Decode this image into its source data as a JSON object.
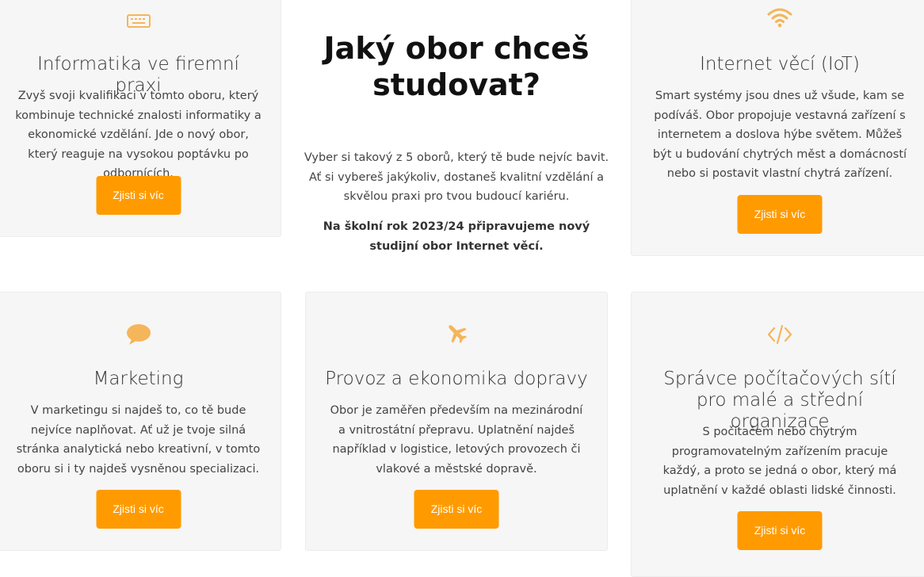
{
  "cta_label": "Zjisti si víc",
  "accent_color": "#ff9b00",
  "intro": {
    "heading": "Jaký obor chceš studovat?",
    "text": "Vyber si takový z 5 oborů, který tě bude nejvíc bavit. Ať si vybereš jakýkoliv, dostaneš kvalitní vzdělání a skvělou praxi pro tvou budoucí kariéru.",
    "note": "Na školní rok 2023/24 připravujeme nový studijní obor Internet věcí."
  },
  "fields": [
    {
      "icon": "keyboard-icon",
      "title": "Informatika ve firemní praxi",
      "description": "Zvyš svoji kvalifikaci v tomto oboru, který kombinuje technické znalosti informatiky a ekonomické vzdělání. Jde o nový obor, který reaguje na vysokou poptávku po odbornících."
    },
    {
      "icon": "wifi-icon",
      "title": "Internet věcí (IoT)",
      "description": "Smart systémy jsou dnes už všude, kam se podíváš. Obor propojuje vestavná zařízení s internetem a doslova hýbe světem. Můžeš být u budování chytrých měst a domácností nebo si postavit vlastní chytrá zařízení."
    },
    {
      "icon": "speech-bubble-icon",
      "title": "Marketing",
      "description": "V marketingu si najdeš to, co tě bude nejvíce naplňovat. Ať už je tvoje silná stránka analytická nebo kreativní, v tomto oboru si i ty najdeš vysněnou specializaci."
    },
    {
      "icon": "airplane-icon",
      "title": "Provoz a ekonomika dopravy",
      "description": "Obor je zaměřen především na mezinárodní a vnitrostátní přepravu. Uplatnění najdeš například v logistice, letových provozech či vlakové a městské dopravě."
    },
    {
      "icon": "code-icon",
      "title": "Správce počítačových sítí pro malé a střední organizace",
      "description": "S počítačem nebo chytrým programovatelným zařízením pracuje každý, a proto se jedná o obor, který má uplatnění v každé oblasti lidské činnosti."
    }
  ]
}
